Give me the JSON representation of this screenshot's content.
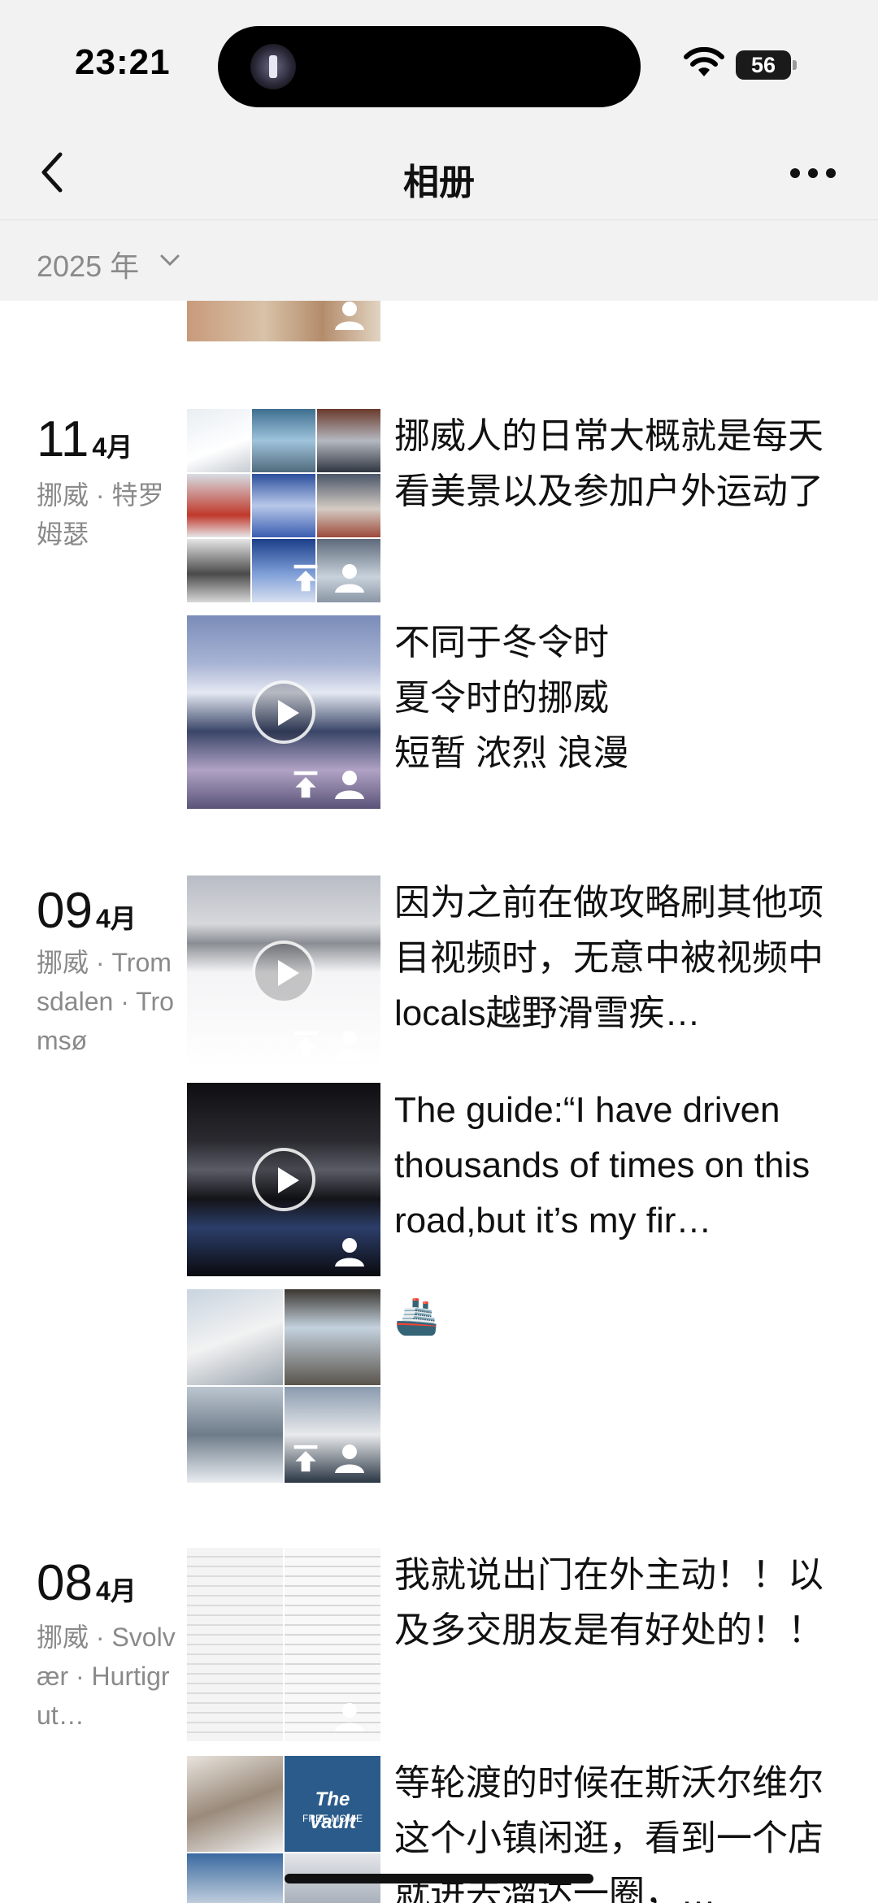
{
  "status": {
    "time": "23:21",
    "battery": "56"
  },
  "nav": {
    "title": "相册"
  },
  "year_filter": {
    "label": "2025 年"
  },
  "entries": [
    {
      "day": "11",
      "month": "4月",
      "location": "挪威 · 特罗姆瑟",
      "posts": [
        {
          "type": "grid",
          "caption": "挪威人的日常大概就是每天看美景以及参加户外运动了"
        },
        {
          "type": "video",
          "caption_lines": [
            "不同于冬令时",
            "夏令时的挪威",
            "短暂 浓烈 浪漫"
          ]
        }
      ]
    },
    {
      "day": "09",
      "month": "4月",
      "location": "挪威 · Tromsdalen · Tromsø",
      "posts": [
        {
          "type": "video",
          "caption": "因为之前在做攻略刷其他项目视频时，无意中被视频中locals越野滑雪疾…"
        },
        {
          "type": "video",
          "caption": "The guide:“I have driven thousands of times on this road,but it’s my fir…"
        },
        {
          "type": "grid",
          "caption": "🚢"
        }
      ]
    },
    {
      "day": "08",
      "month": "4月",
      "location": "挪威 · Svolvær · Hurtigrut…",
      "posts": [
        {
          "type": "grid",
          "caption": "我就说出门在外主动！！以及多交朋友是有好处的！！"
        },
        {
          "type": "grid",
          "caption": "等轮渡的时候在斯沃尔维尔这个小镇闲逛，看到一个店就进去溜达一圈，…",
          "tile_text": "The Vault",
          "tile_subtext": "FREE MOVIE"
        }
      ]
    }
  ],
  "icons": [
    "back-chevron-icon",
    "more-dots-icon",
    "chevron-down-icon",
    "play-icon",
    "upload-icon",
    "person-icon",
    "wifi-icon",
    "battery-icon"
  ]
}
